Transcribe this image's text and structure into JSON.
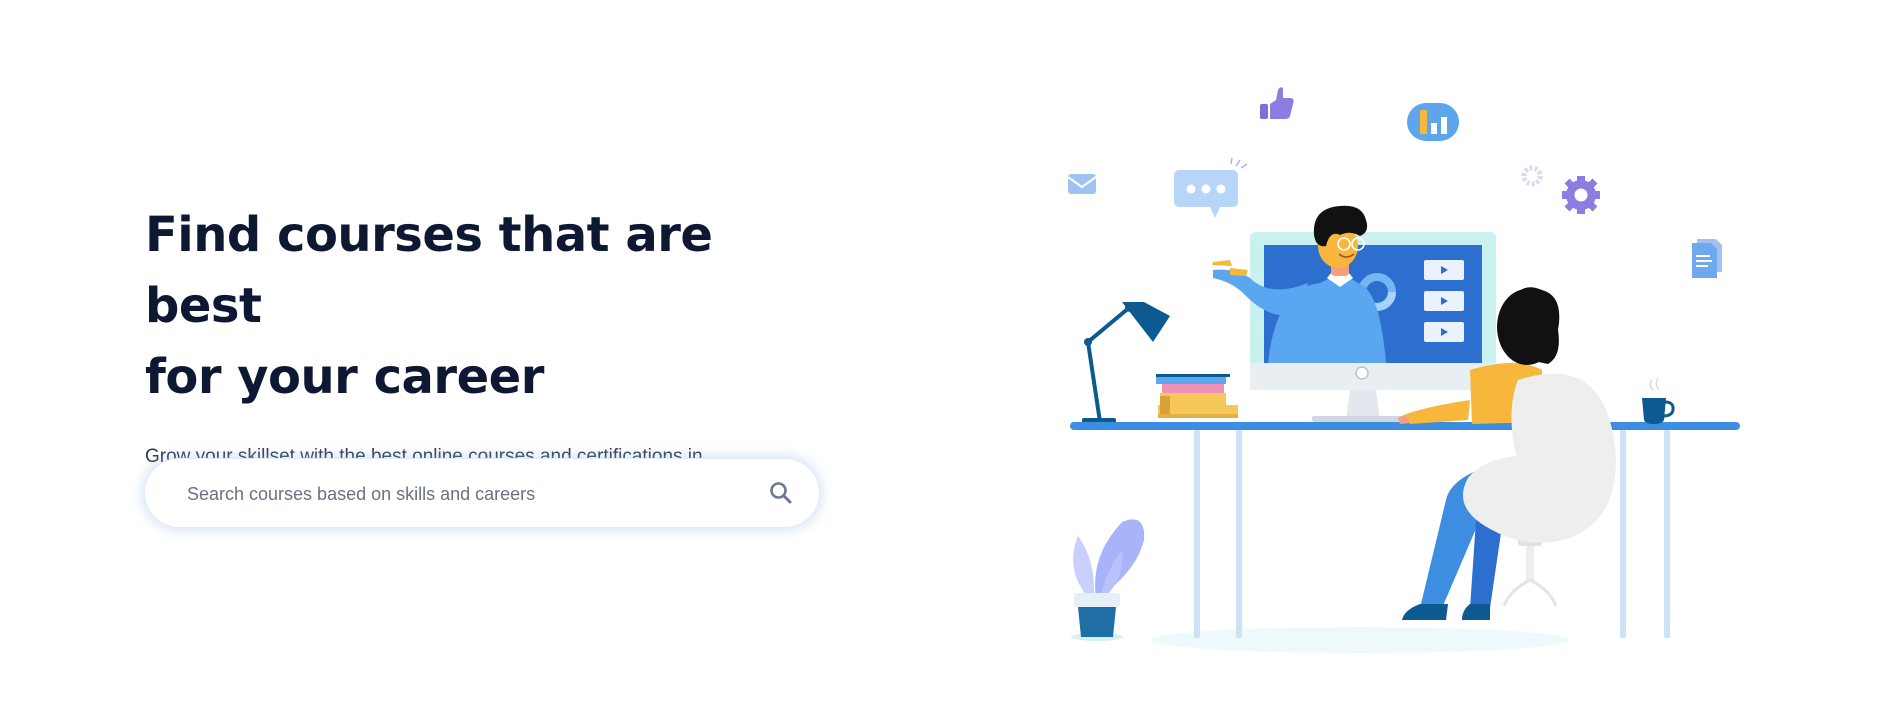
{
  "hero": {
    "title_line1": "Find courses that are best",
    "title_line2": "for your career",
    "subtitle": "Grow your skillset with the best online courses and certifications in management, technology, programming, and data science."
  },
  "search": {
    "placeholder": "Search courses based on skills and careers",
    "icon": "search-icon"
  },
  "illustration": {
    "icons": [
      "thumbs-up-icon",
      "bar-chart-icon",
      "mail-icon",
      "chat-bubble-icon",
      "gear-icon",
      "document-icon",
      "play-icon",
      "coffee-cup-icon",
      "desk-lamp-icon",
      "plant-icon"
    ]
  },
  "colors": {
    "title": "#0f1833",
    "subtitle": "#2e3850",
    "accent_blue": "#3d8ee0",
    "dark_blue": "#0c5a8f",
    "purple": "#8a7ee0",
    "yellow": "#f6b73c"
  }
}
